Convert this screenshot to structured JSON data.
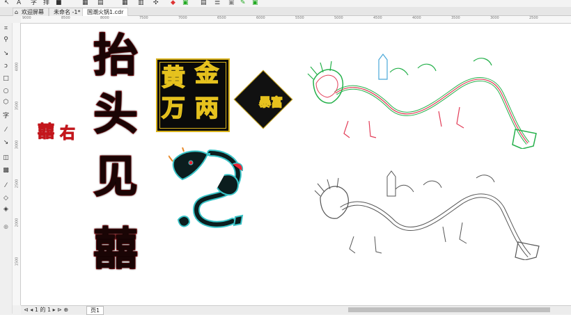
{
  "tabs": [
    {
      "label": "欢迎屏幕"
    },
    {
      "label": "未命名 -1*"
    },
    {
      "label": "国潮火锅1.cdr"
    }
  ],
  "ruler": {
    "h_ticks": [
      "9000",
      "8500",
      "8000",
      "7500",
      "7000",
      "6500",
      "6000",
      "5500",
      "5000",
      "4500",
      "4000",
      "3500",
      "3000",
      "2500"
    ],
    "v_ticks": [
      "4000",
      "3500",
      "3000",
      "2500",
      "2000",
      "1500"
    ]
  },
  "artwork": {
    "col1": [
      "抬",
      "头",
      "见",
      "囍"
    ],
    "side_text": [
      "囍",
      "右"
    ],
    "gold": [
      "黄",
      "金",
      "万",
      "两"
    ],
    "diamond": "暴富"
  },
  "statusbar": {
    "page_nav": "1 的 1",
    "page_tab": "页1"
  },
  "colors": {
    "accent_red": "#c4161c",
    "gold": "#e6c21e",
    "teal": "#39c3c7"
  }
}
